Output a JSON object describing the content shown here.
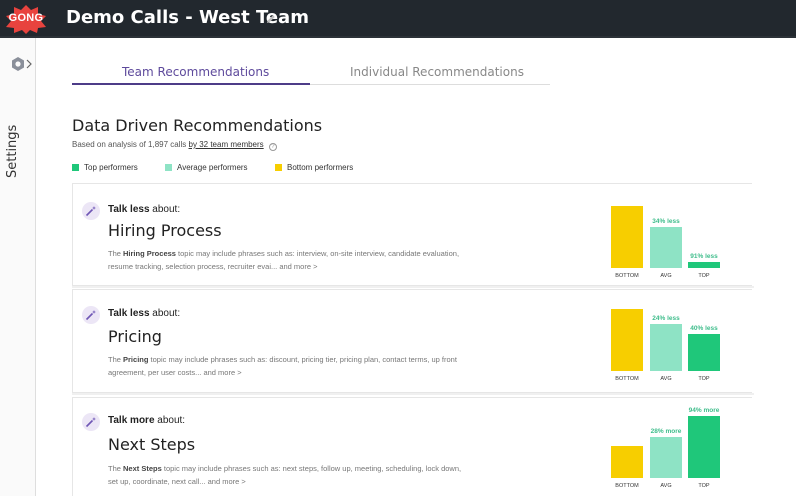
{
  "colors": {
    "top": "#1fc77a",
    "average": "#8ee3c5",
    "bottom": "#f7ce00",
    "accent": "#4d3c88"
  },
  "app": {
    "logo": "GONG",
    "title": "Demo Calls - West Team"
  },
  "sidebar": {
    "label": "Settings"
  },
  "tabs": [
    {
      "label": "Team Recommendations",
      "active": true
    },
    {
      "label": "Individual Recommendations",
      "active": false
    }
  ],
  "main": {
    "heading": "Data Driven Recommendations",
    "sub_prefix": "Based on analysis of 1,897 calls",
    "sub_link": "by 32 team members",
    "help": "?",
    "legend": [
      "Top performers",
      "Average performers",
      "Bottom performers"
    ]
  },
  "cards": [
    {
      "verb": "Talk less",
      "suffix": " about:",
      "topic": "Hiring Process",
      "desc_prefix": "The ",
      "desc_topic": "Hiring Process",
      "desc_body": " topic may include phrases such as: interview, on-site interview, candidate evaluation, resume tracking, selection process, recruiter evai... and more >",
      "bars": [
        {
          "label": "BOTTOM",
          "value": 1.0,
          "pct": ""
        },
        {
          "label": "AVG",
          "value": 0.66,
          "pct": "34% less"
        },
        {
          "label": "TOP",
          "value": 0.09,
          "pct": "91% less"
        }
      ]
    },
    {
      "verb": "Talk less",
      "suffix": " about:",
      "topic": "Pricing",
      "desc_prefix": "The ",
      "desc_topic": "Pricing",
      "desc_body": " topic may include phrases such as: discount, pricing tier, pricing plan, contact terms, up front agreement, per user costs... and more >",
      "bars": [
        {
          "label": "BOTTOM",
          "value": 1.0,
          "pct": ""
        },
        {
          "label": "AVG",
          "value": 0.76,
          "pct": "24% less"
        },
        {
          "label": "TOP",
          "value": 0.6,
          "pct": "40% less"
        }
      ]
    },
    {
      "verb": "Talk more",
      "suffix": " about:",
      "topic": "Next Steps",
      "desc_prefix": "The ",
      "desc_topic": "Next Steps",
      "desc_body": " topic may include phrases such as: next steps, follow up, meeting, scheduling, lock down, set up, coordinate, next call... and more >",
      "bars": [
        {
          "label": "BOTTOM",
          "value": 1.0,
          "pct": ""
        },
        {
          "label": "AVG",
          "value": 1.28,
          "pct": "28% more"
        },
        {
          "label": "TOP",
          "value": 1.94,
          "pct": "94% more"
        }
      ]
    }
  ]
}
